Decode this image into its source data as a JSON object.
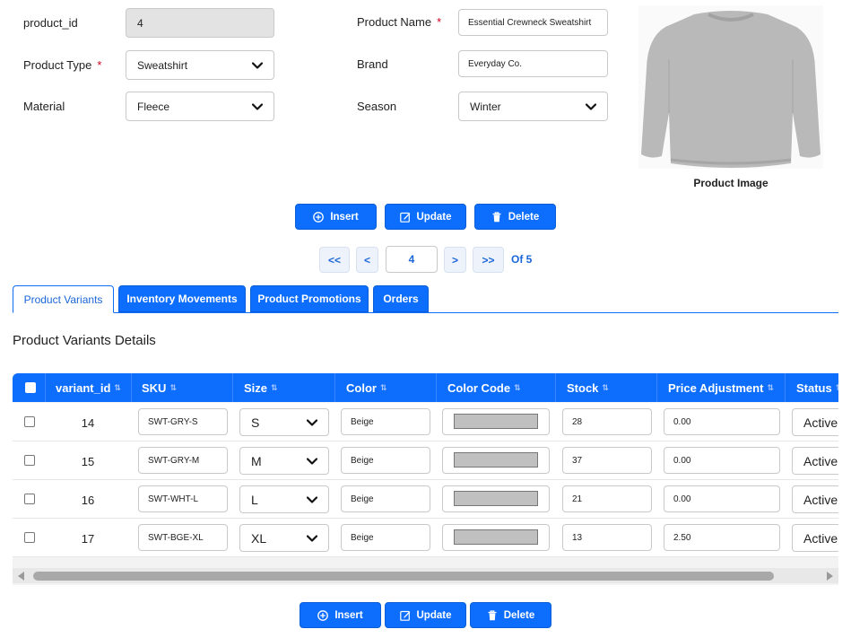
{
  "form": {
    "product_id": {
      "label": "product_id",
      "value": "4"
    },
    "product_type": {
      "label": "Product Type",
      "required": "*",
      "value": "Sweatshirt"
    },
    "material": {
      "label": "Material",
      "value": "Fleece"
    },
    "product_name": {
      "label": "Product Name",
      "required": "*",
      "value": "Essential Crewneck Sweatshirt"
    },
    "brand": {
      "label": "Brand",
      "value": "Everyday Co."
    },
    "season": {
      "label": "Season",
      "value": "Winter"
    }
  },
  "image": {
    "caption": "Product Image",
    "color": "#b9b9b9"
  },
  "actions": {
    "insert": "Insert",
    "update": "Update",
    "delete": "Delete"
  },
  "pager": {
    "first": "<<",
    "prev": "<",
    "current": "4",
    "next": ">",
    "last": ">>",
    "of": "Of 5"
  },
  "tabs": [
    {
      "label": "Product Variants",
      "active": true
    },
    {
      "label": "Inventory Movements",
      "active": false
    },
    {
      "label": "Product Promotions",
      "active": false
    },
    {
      "label": "Orders",
      "active": false
    }
  ],
  "section_title": "Product Variants Details",
  "table": {
    "sort_glyph": "⇅",
    "columns": [
      "variant_id",
      "SKU",
      "Size",
      "Color",
      "Color Code",
      "Stock",
      "Price Adjustment",
      "Status"
    ],
    "rows": [
      {
        "variant_id": "14",
        "sku": "SWT-GRY-S",
        "size": "S",
        "color": "Beige",
        "color_code": "#c0c0c0",
        "stock": "28",
        "price_adjustment": "0.00",
        "status": "Active"
      },
      {
        "variant_id": "15",
        "sku": "SWT-GRY-M",
        "size": "M",
        "color": "Beige",
        "color_code": "#c0c0c0",
        "stock": "37",
        "price_adjustment": "0.00",
        "status": "Active"
      },
      {
        "variant_id": "16",
        "sku": "SWT-WHT-L",
        "size": "L",
        "color": "Beige",
        "color_code": "#c0c0c0",
        "stock": "21",
        "price_adjustment": "0.00",
        "status": "Active"
      },
      {
        "variant_id": "17",
        "sku": "SWT-BGE-XL",
        "size": "XL",
        "color": "Beige",
        "color_code": "#c0c0c0",
        "stock": "13",
        "price_adjustment": "2.50",
        "status": "Active"
      }
    ]
  },
  "colors": {
    "primary": "#0d6efd",
    "required": "#d0021b"
  }
}
